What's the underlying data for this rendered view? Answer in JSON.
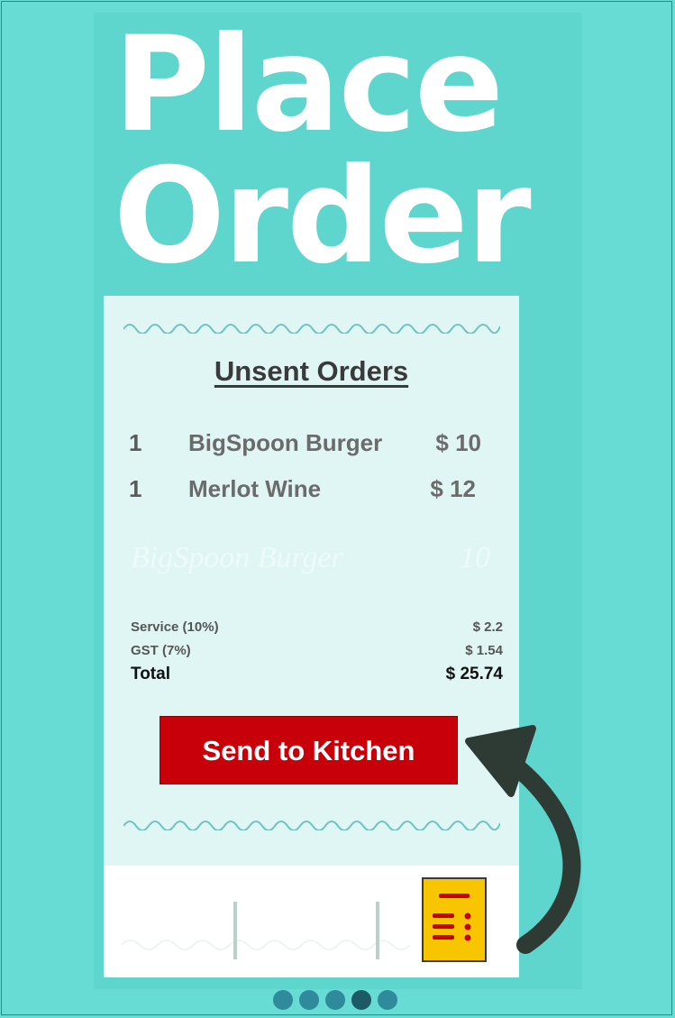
{
  "headline": {
    "line1": "Place",
    "line2": "Order"
  },
  "receipt": {
    "title": "Unsent Orders",
    "items": [
      {
        "qty": "1",
        "name": "BigSpoon Burger",
        "price": "$ 10"
      },
      {
        "qty": "1",
        "name": "Merlot Wine",
        "price": "$ 12"
      }
    ],
    "ghost_row": {
      "name": "BigSpoon Burger",
      "price": "10"
    },
    "service": {
      "label": "Service (10%)",
      "value": "$ 2.2"
    },
    "gst": {
      "label": "GST (7%)",
      "value": "$ 1.54"
    },
    "total": {
      "label": "Total",
      "value": "$ 25.74"
    },
    "send_button_label": "Send to Kitchen"
  },
  "tabbar": {
    "active_icon": "order-list-icon"
  },
  "pager": {
    "count": 5,
    "active_index": 3
  },
  "colors": {
    "background": "#66dcd4",
    "receipt": "#e0f6f4",
    "send_button": "#c8000a",
    "active_tab_icon": "#f8c600",
    "arrow": "#2e3a34"
  }
}
